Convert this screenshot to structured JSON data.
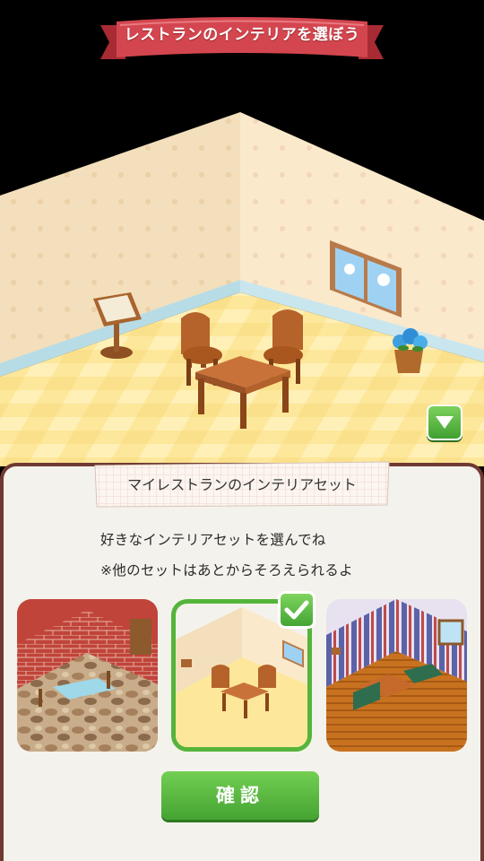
{
  "header": {
    "title": "レストランのインテリアを選ぼう"
  },
  "panel": {
    "title": "マイレストランのインテリアセット",
    "description_line1": "好きなインテリアセットを選んでね",
    "description_line2": "※他のセットはあとからそろえられるよ"
  },
  "interior_sets": [
    {
      "name": "stone-brick-set",
      "selected": false
    },
    {
      "name": "wood-basic-set",
      "selected": true
    },
    {
      "name": "striped-sofa-set",
      "selected": false
    }
  ],
  "buttons": {
    "confirm_label": "確認"
  },
  "colors": {
    "accent_green": "#4caf32",
    "ribbon_red": "#d4464f",
    "panel_border": "#6e3a32"
  }
}
